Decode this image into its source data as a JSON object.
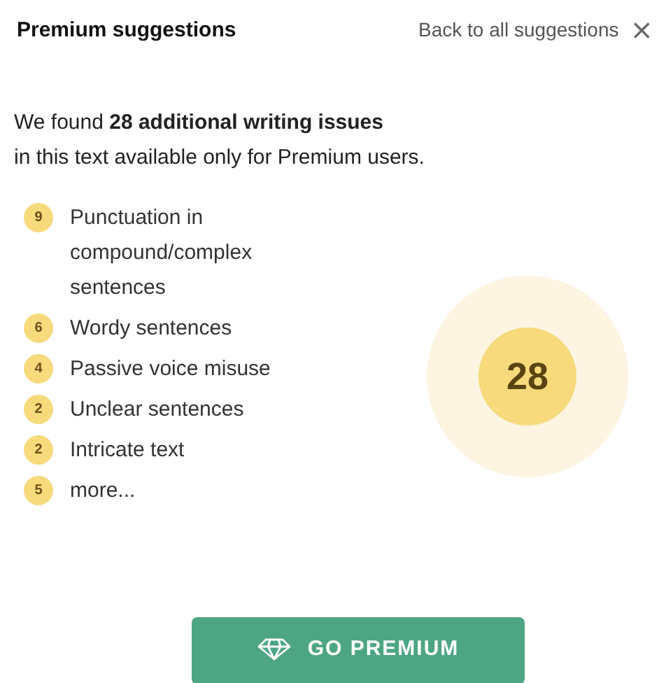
{
  "header": {
    "title": "Premium suggestions",
    "back_link": "Back to all suggestions",
    "close": "×"
  },
  "intro": {
    "line_1": "We found **28 additional writing issues**",
    "line_2": "in this text available only for Premium users."
  },
  "issues": [
    {
      "count": "9",
      "label": "Punctuation in compound/complex sentences"
    },
    {
      "count": "6",
      "label": "Wordy sentences"
    },
    {
      "count": "4",
      "label": "Passive voice misuse"
    },
    {
      "count": "2",
      "label": "Unclear sentences"
    },
    {
      "count": "2",
      "label": "Intricate text"
    },
    {
      "count": "5",
      "label": "more..."
    }
  ],
  "total": "28",
  "button": "GO PREMIUM"
}
